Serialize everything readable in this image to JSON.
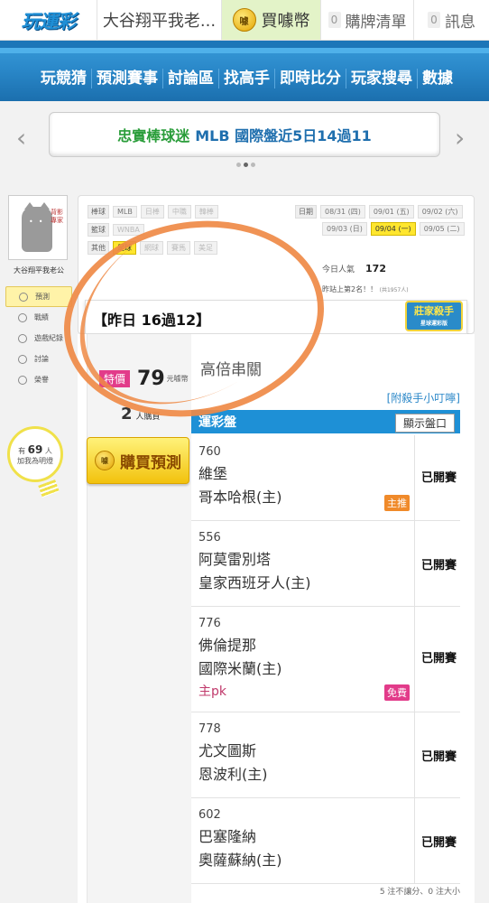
{
  "topbar": {
    "logo": "玩運彩",
    "user_tab": "大谷翔平我老...",
    "buy_coin": "買噱幣",
    "coin_icon_text": "噱",
    "cart_count": "0",
    "cart_label": "購牌清單",
    "msg_count": "0",
    "msg_label": "訊息"
  },
  "nav": {
    "items": [
      "玩競猜",
      "預測賽事",
      "討論區",
      "找高手",
      "即時比分",
      "玩家搜尋",
      "數據"
    ]
  },
  "banner": {
    "text_a": "忠實棒球迷",
    "text_b": "MLB 國際盤近5日14過11",
    "prev": "‹",
    "next": "›"
  },
  "sidebar": {
    "avatar_sign": "背影專家",
    "username": "大谷翔平我老公",
    "items": [
      {
        "label": "預測",
        "icon": "target-icon"
      },
      {
        "label": "戰績",
        "icon": "chat-icon"
      },
      {
        "label": "遊戲紀錄",
        "icon": "record-icon"
      },
      {
        "label": "討論",
        "icon": "edit-icon"
      },
      {
        "label": "榮譽",
        "icon": "medal-icon"
      }
    ],
    "bulb_prefix": "有",
    "bulb_count": "69",
    "bulb_unit": "人",
    "bulb_text": "加我為明燈"
  },
  "filters": {
    "baseball_label": "棒球",
    "baseball": [
      "MLB",
      "日棒",
      "中職",
      "韓棒"
    ],
    "basketball_label": "籃球",
    "basketball": [
      "WNBA"
    ],
    "other_label": "其他",
    "other": [
      "足球",
      "網球",
      "賽馬",
      "美足"
    ],
    "date_label": "日期",
    "dates_row1": [
      "08/31 (四)",
      "09/01 (五)",
      "09/02 (六)"
    ],
    "dates_row2": [
      "09/03 (日)",
      "09/04 (一)",
      "09/05 (二)"
    ],
    "selected_date": "09/04 (一)",
    "popularity_label": "今日人氣",
    "popularity_value": "172",
    "rank_text": "昨站上第2名！！",
    "rank_small": "(共1957人)"
  },
  "yesterday": {
    "text": "【昨日 16過12】",
    "badge_main": "莊家殺手",
    "badge_sub": "星球運彩版"
  },
  "listing": {
    "special_tag": "特價",
    "price": "79",
    "price_unit": "元噱幣",
    "buyers": "2",
    "buyers_unit": "人購買",
    "buy_button": "購買預測",
    "type_title": "高倍串關",
    "hint_link": "[附殺手小叮嚀]",
    "table_title": "運彩盤",
    "show_odds_button": "顯示盤口",
    "games": [
      {
        "no": "760",
        "away": "維堡",
        "home": "哥本哈根(主)",
        "tag": "主推",
        "tag_type": "main",
        "pick": "",
        "status": "已開賽"
      },
      {
        "no": "556",
        "away": "阿莫雷別塔",
        "home": "皇家西班牙人(主)",
        "tag": "",
        "tag_type": "",
        "pick": "",
        "status": "已開賽"
      },
      {
        "no": "776",
        "away": "佛倫提那",
        "home": "國際米蘭(主)",
        "tag": "免費",
        "tag_type": "free",
        "pick": "主pk",
        "status": "已開賽"
      },
      {
        "no": "778",
        "away": "尤文圖斯",
        "home": "恩波利(主)",
        "tag": "",
        "tag_type": "",
        "pick": "",
        "status": "已開賽"
      },
      {
        "no": "602",
        "away": "巴塞隆納",
        "home": "奧薩蘇納(主)",
        "tag": "",
        "tag_type": "",
        "pick": "",
        "status": "已開賽"
      }
    ],
    "footer_note": "5 注不讓分、0 注大小"
  },
  "colors": {
    "nav_blue": "#2a88c9",
    "accent_yellow": "#ffe62e",
    "table_head_blue": "#1e90d6",
    "scribble_orange": "#ef8a46",
    "pk_pink": "#c0396b"
  }
}
